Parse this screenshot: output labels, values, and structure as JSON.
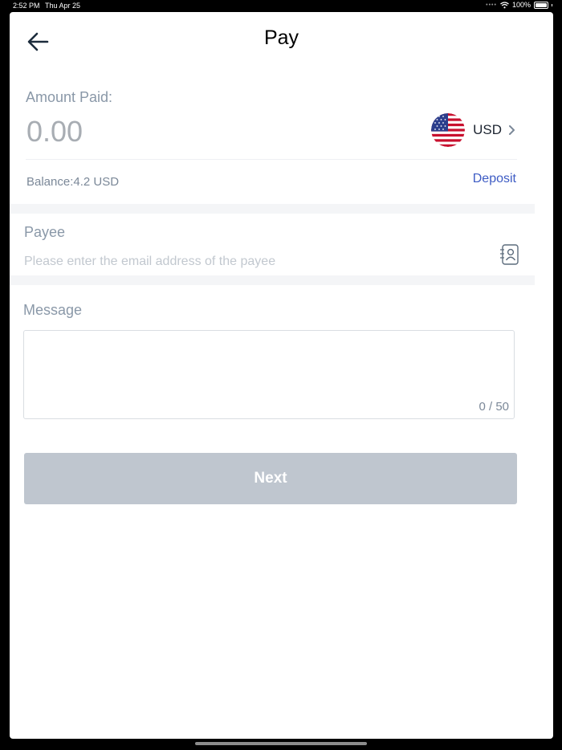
{
  "status_bar": {
    "time": "2:52 PM",
    "date": "Thu Apr 25",
    "battery": "100%"
  },
  "header": {
    "title": "Pay"
  },
  "amount": {
    "label": "Amount Paid:",
    "value": "0.00",
    "currency_code": "USD",
    "balance": "Balance:4.2 USD",
    "deposit_label": "Deposit"
  },
  "payee": {
    "label": "Payee",
    "placeholder": "Please enter the email address of the payee",
    "value": ""
  },
  "message": {
    "label": "Message",
    "counter": "0 / 50",
    "value": ""
  },
  "actions": {
    "next_label": "Next"
  },
  "colors": {
    "accent": "#3e5cc4",
    "button_disabled": "#bfc6cf",
    "label": "#8a98a8"
  },
  "icons": [
    "back-arrow-icon",
    "us-flag-icon",
    "chevron-right-icon",
    "contact-book-icon",
    "wifi-icon",
    "battery-icon"
  ]
}
